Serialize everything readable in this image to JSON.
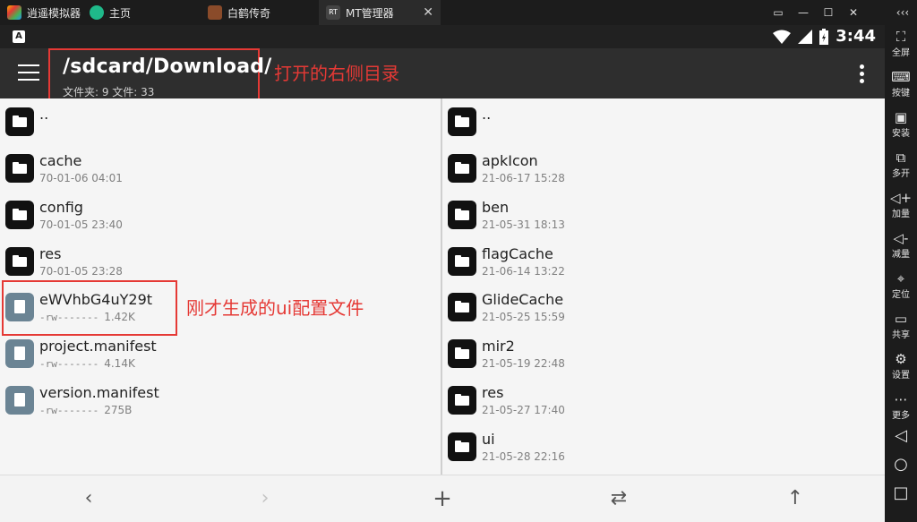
{
  "tabs": [
    {
      "label": "逍遥模拟器",
      "icon": "emulator-logo-icon"
    },
    {
      "label": "主页",
      "icon": "home-icon"
    },
    {
      "label": "白鹤传奇",
      "icon": "game-icon"
    },
    {
      "label": "MT管理器",
      "icon": "mt-manager-icon"
    }
  ],
  "window_controls": {
    "list": "▭",
    "min": "—",
    "max": "☐",
    "close": "✕",
    "collapse": "‹‹‹"
  },
  "status": {
    "time": "3:44",
    "a_icon": "A"
  },
  "toolbar": {
    "path": "/sdcard/Download/",
    "summary": "文件夹: 9  文件: 33",
    "annotation": "打开的右侧目录"
  },
  "left_pane": {
    "items": [
      {
        "type": "folder",
        "name": "..",
        "meta": ""
      },
      {
        "type": "folder",
        "name": "cache",
        "meta": "70-01-06 04:01"
      },
      {
        "type": "folder",
        "name": "config",
        "meta": "70-01-05 23:40"
      },
      {
        "type": "folder",
        "name": "res",
        "meta": "70-01-05 23:28"
      },
      {
        "type": "file",
        "name": "eWVhbG4uY29t",
        "perm": "-rw-------",
        "size": "1.42K"
      },
      {
        "type": "file",
        "name": "project.manifest",
        "perm": "-rw-------",
        "size": "4.14K"
      },
      {
        "type": "file",
        "name": "version.manifest",
        "perm": "-rw-------",
        "size": "275B"
      }
    ],
    "annotation": "刚才生成的ui配置文件"
  },
  "right_pane": {
    "items": [
      {
        "type": "folder",
        "name": "..",
        "meta": ""
      },
      {
        "type": "folder",
        "name": "apkIcon",
        "meta": "21-06-17 15:28"
      },
      {
        "type": "folder",
        "name": "ben",
        "meta": "21-05-31 18:13"
      },
      {
        "type": "folder",
        "name": "flagCache",
        "meta": "21-06-14 13:22"
      },
      {
        "type": "folder",
        "name": "GlideCache",
        "meta": "21-05-25 15:59"
      },
      {
        "type": "folder",
        "name": "mir2",
        "meta": "21-05-19 22:48"
      },
      {
        "type": "folder",
        "name": "res",
        "meta": "21-05-27 17:40"
      },
      {
        "type": "folder",
        "name": "ui",
        "meta": "21-05-28 22:16"
      }
    ]
  },
  "bottom": {
    "back": "‹",
    "forward": "›",
    "add": "+",
    "swap": "⇄",
    "up": "↑"
  },
  "sidebar": [
    {
      "label": "全屏",
      "glyph": "⛶",
      "icon": "fullscreen-icon"
    },
    {
      "label": "按键",
      "glyph": "⌨",
      "icon": "keyboard-icon"
    },
    {
      "label": "安装",
      "glyph": "▣",
      "icon": "apk-install-icon"
    },
    {
      "label": "多开",
      "glyph": "⧉",
      "icon": "multi-instance-icon"
    },
    {
      "label": "加量",
      "glyph": "◁+",
      "icon": "volume-up-icon"
    },
    {
      "label": "减量",
      "glyph": "◁-",
      "icon": "volume-down-icon"
    },
    {
      "label": "定位",
      "glyph": "⌖",
      "icon": "location-icon"
    },
    {
      "label": "共享",
      "glyph": "▭",
      "icon": "share-folder-icon"
    },
    {
      "label": "设置",
      "glyph": "⚙",
      "icon": "settings-icon"
    },
    {
      "label": "更多",
      "glyph": "⋯",
      "icon": "more-icon"
    }
  ],
  "android_nav": {
    "back": "◁",
    "home": "○",
    "recents": "□"
  },
  "colors": {
    "annotation": "#e53935",
    "toolbar": "#2e2e2e",
    "file_icon": "#6b8494",
    "folder_icon": "#111111"
  }
}
